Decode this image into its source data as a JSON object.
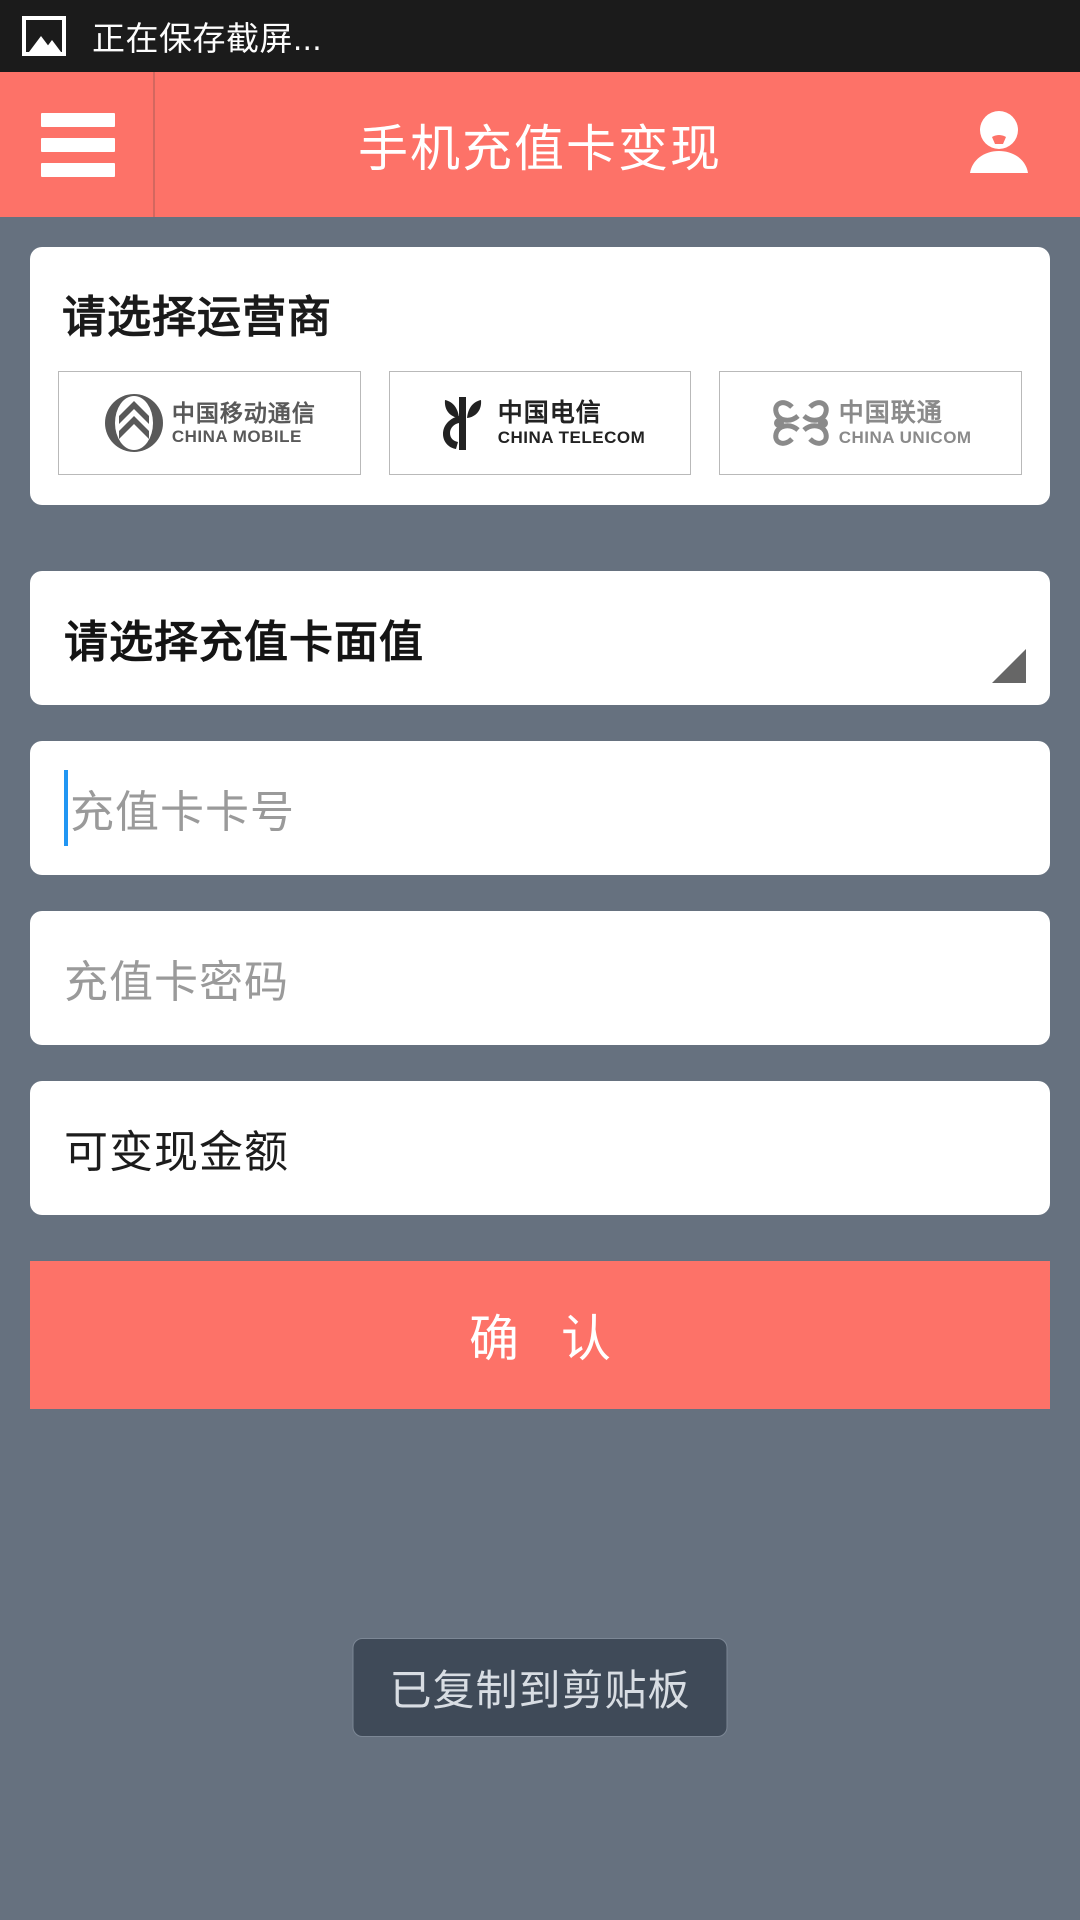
{
  "status_bar": {
    "icon": "image-icon",
    "text": "正在保存截屏..."
  },
  "header": {
    "menu_icon": "hamburger-menu-icon",
    "title": "手机充值卡变现",
    "account_icon": "user-avatar-icon",
    "background_color": "#fd7268",
    "text_color": "#ffffff"
  },
  "page": {
    "background_color": "#66717f"
  },
  "carrier_section": {
    "title": "请选择运营商",
    "carriers": [
      {
        "cn": "中国移动通信",
        "en": "CHINA MOBILE",
        "icon": "china-mobile-logo",
        "color": "#595959"
      },
      {
        "cn": "中国电信",
        "en": "CHINA TELECOM",
        "icon": "china-telecom-logo",
        "color": "#222222"
      },
      {
        "cn": "中国联通",
        "en": "CHINA UNICOM",
        "icon": "china-unicom-logo",
        "color": "#8a8a8a"
      }
    ]
  },
  "denomination_select": {
    "label": "请选择充值卡面值",
    "arrow_icon": "dropdown-triangle-icon",
    "arrow_color": "#666666"
  },
  "fields": {
    "card_number": {
      "placeholder": "充值卡卡号",
      "value": "",
      "focused": true,
      "caret_color": "#2196f3"
    },
    "card_password": {
      "placeholder": "充值卡密码",
      "value": "",
      "focused": false
    },
    "cashable_amount": {
      "label": "可变现金额",
      "value": "",
      "readonly": true
    }
  },
  "confirm_button": {
    "label": "确 认",
    "background_color": "#fd7268",
    "text_color": "#ffffff"
  },
  "toast": {
    "message": "已复制到剪贴板",
    "background_color": "#3f4a58",
    "text_color": "#d8dde3"
  }
}
